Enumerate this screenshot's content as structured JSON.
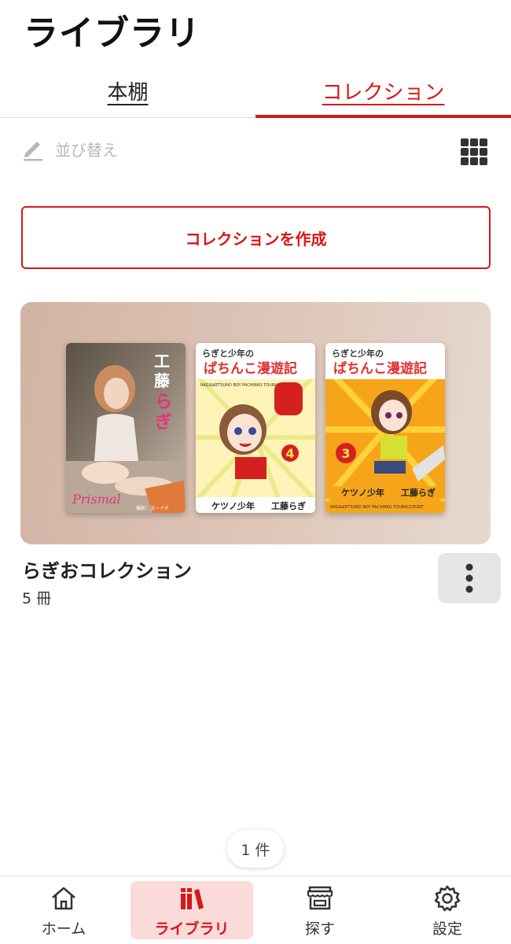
{
  "header": {
    "title": "ライブラリ"
  },
  "tabs": [
    {
      "label": "本棚",
      "active": false
    },
    {
      "label": "コレクション",
      "active": true
    }
  ],
  "toolbar": {
    "sort_label": "並び替え",
    "sort_icon": "pencil-icon",
    "view_icon": "grid-icon"
  },
  "create_button": {
    "label": "コレクションを作成"
  },
  "collections": [
    {
      "name": "らぎおコレクション",
      "count": "5 冊",
      "covers": [
        {
          "title": "工藤らぎ",
          "subtitle": "Prismal",
          "credit": "撮影：ヨーイチ"
        },
        {
          "title_top": "らぎと少年の",
          "title_main": "ぱちんこ漫遊記",
          "roman": "RAGI&KETSUNO BOY PACHINKO TOURACCOUNT",
          "volume": "4",
          "author": "ケツノ少年",
          "artist": "工藤らぎ"
        },
        {
          "title_top": "らぎと少年の",
          "title_main": "ぱちんこ漫遊記",
          "roman": "RAGI&KETSUNO BOY PACHINKO TOURACCOUNT",
          "volume": "3",
          "author": "ケツノ少年",
          "artist": "工藤らぎ"
        }
      ]
    }
  ],
  "result_count": "1 件",
  "bottom_nav": [
    {
      "label": "ホーム",
      "icon": "home-icon",
      "active": false
    },
    {
      "label": "ライブラリ",
      "icon": "library-icon",
      "active": true
    },
    {
      "label": "探す",
      "icon": "store-icon",
      "active": false
    },
    {
      "label": "設定",
      "icon": "gear-icon",
      "active": false
    }
  ],
  "colors": {
    "accent": "#d71818",
    "nav_active_bg": "#fbdada",
    "muted": "#b8b8b8"
  }
}
